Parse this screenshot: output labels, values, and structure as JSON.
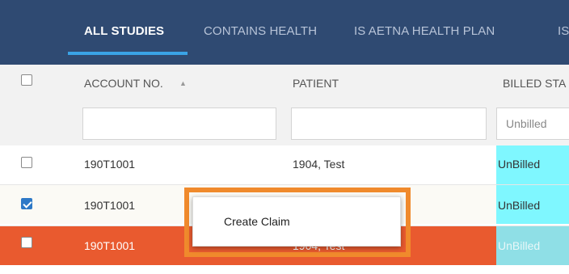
{
  "tabs": [
    {
      "label": "ALL STUDIES",
      "active": true
    },
    {
      "label": "CONTAINS HEALTH",
      "active": false
    },
    {
      "label": "IS AETNA HEALTH PLAN",
      "active": false
    },
    {
      "label": "IS",
      "active": false
    }
  ],
  "table": {
    "columns": [
      "ACCOUNT NO.",
      "PATIENT",
      "BILLED STA"
    ],
    "filters": {
      "account_no": "",
      "patient": "",
      "billed_status": "Unbilled"
    },
    "rows": [
      {
        "account_no": "190T1001",
        "patient": "1904, Test",
        "billed_status": "UnBilled",
        "checked": false,
        "highlight": false
      },
      {
        "account_no": "190T1001",
        "patient": "",
        "billed_status": "UnBilled",
        "checked": true,
        "highlight": false
      },
      {
        "account_no": "190T1001",
        "patient": "1904, Test",
        "billed_status": "UnBilled",
        "checked": false,
        "highlight": true
      }
    ]
  },
  "context_menu": {
    "items": [
      "Create Claim"
    ]
  },
  "colors": {
    "tab_bar": "#2f4a72",
    "tab_underline": "#3aa3e6",
    "billed_cell": "#7ff7ff",
    "selected_row": "#e95a2f",
    "menu_outline": "#f08a2c",
    "checkbox_checked": "#2e79c7"
  }
}
